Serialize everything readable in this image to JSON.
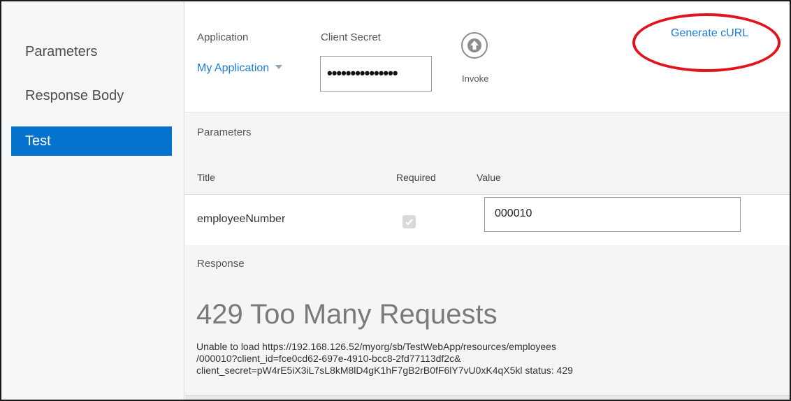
{
  "sidebar": {
    "items": [
      {
        "label": "Parameters"
      },
      {
        "label": "Response Body"
      },
      {
        "label": "Test"
      }
    ]
  },
  "toolbar": {
    "application_label": "Application",
    "application_value": "My Application",
    "client_secret_label": "Client Secret",
    "client_secret_value": "•••••••••••••••",
    "invoke_label": "Invoke",
    "generate_curl_label": "Generate cURL"
  },
  "parameters": {
    "title": "Parameters",
    "columns": {
      "title": "Title",
      "required": "Required",
      "value": "Value"
    },
    "rows": [
      {
        "title": "employeeNumber",
        "required": true,
        "value": "000010"
      }
    ]
  },
  "response": {
    "title": "Response",
    "status": "429 Too Many Requests",
    "message_lines": [
      "Unable to load https://192.168.126.52/myorg/sb/TestWebApp/resources/employees",
      "/000010?client_id=fce0cd62-697e-4910-bcc8-2fd77113df2c&",
      "client_secret=pW4rE5iX3iL7sL8kM8lD4gK1hF7gB2rB0fF6lY7vU0xK4qX5kl status: 429"
    ]
  },
  "colors": {
    "accent": "#0572ce",
    "link": "#1c7ed6",
    "annotation": "#e2131b"
  }
}
